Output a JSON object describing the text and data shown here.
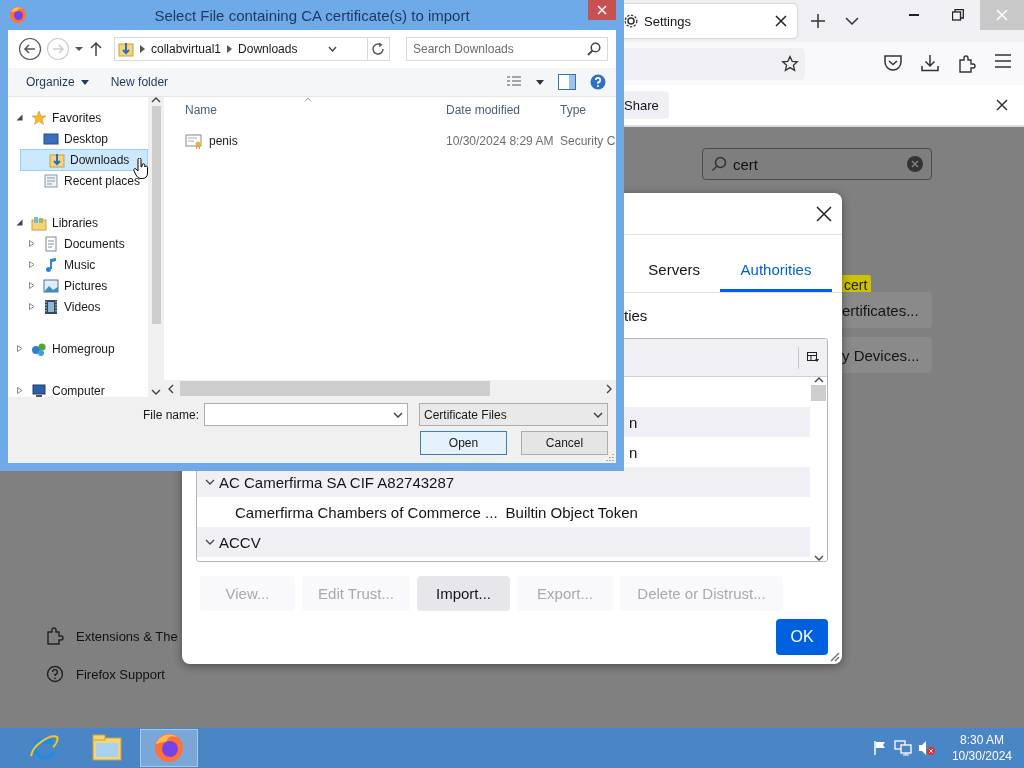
{
  "browser": {
    "tab": {
      "title": "Settings",
      "selected": true
    },
    "notification_bar": {
      "button": "Share"
    },
    "settings_search": {
      "value": "cert"
    },
    "search_highlight": "cert",
    "settings_buttons": [
      "ertificates...",
      "y Devices..."
    ],
    "sidebar_links": [
      {
        "kind": "extensions",
        "label": "Extensions & The"
      },
      {
        "kind": "support",
        "label": "Firefox Support"
      }
    ]
  },
  "certificate_manager": {
    "tabs": [
      {
        "label": "Servers",
        "selected": false
      },
      {
        "label": "Authorities",
        "selected": true
      }
    ],
    "caption": "ties",
    "rows": [
      {
        "kind": "partial",
        "text": "n"
      },
      {
        "kind": "partial",
        "text": "n"
      },
      {
        "kind": "group",
        "text": "AC Camerfirma SA CIF A82743287",
        "expanded": true
      },
      {
        "kind": "cert",
        "text": "Camerfirma Chambers of Commerce ...",
        "token": "Builtin Object Token"
      },
      {
        "kind": "group",
        "text": "ACCV",
        "expanded": true
      }
    ],
    "buttons": [
      {
        "label": "View...",
        "disabled": true
      },
      {
        "label": "Edit Trust...",
        "disabled": true
      },
      {
        "label": "Import...",
        "disabled": false
      },
      {
        "label": "Export...",
        "disabled": true
      },
      {
        "label": "Delete or Distrust...",
        "disabled": true
      }
    ],
    "ok_button": "OK"
  },
  "file_dialog": {
    "title": "Select File containing CA certificate(s) to import",
    "breadcrumb": [
      "collabvirtual1",
      "Downloads"
    ],
    "search": {
      "placeholder": "Search Downloads"
    },
    "toolbar": [
      {
        "label": "Organize",
        "menu": true
      },
      {
        "label": "New folder",
        "menu": false
      }
    ],
    "tree": [
      {
        "label": "Favorites",
        "kind": "favorites",
        "expanded": true,
        "selected": false,
        "children": [
          {
            "label": "Desktop",
            "kind": "desktop",
            "selected": false
          },
          {
            "label": "Downloads",
            "kind": "downloads",
            "selected": true
          },
          {
            "label": "Recent places",
            "kind": "recent",
            "selected": false
          }
        ]
      },
      {
        "label": "Libraries",
        "kind": "libraries",
        "expanded": true,
        "selected": false,
        "children": [
          {
            "label": "Documents",
            "kind": "documents",
            "expanded": false,
            "selected": false
          },
          {
            "label": "Music",
            "kind": "music",
            "expanded": false,
            "selected": false
          },
          {
            "label": "Pictures",
            "kind": "pictures",
            "expanded": false,
            "selected": false
          },
          {
            "label": "Videos",
            "kind": "videos",
            "expanded": false,
            "selected": false
          }
        ]
      },
      {
        "label": "Homegroup",
        "kind": "homegroup",
        "expanded": false,
        "selected": false
      },
      {
        "label": "Computer",
        "kind": "computer",
        "expanded": false,
        "selected": false
      }
    ],
    "columns": [
      "Name",
      "Date modified",
      "Type"
    ],
    "files": [
      {
        "name": "penis",
        "date_modified": "10/30/2024 8:29 AM",
        "type": "Security C"
      }
    ],
    "file_name": {
      "label": "File name:"
    },
    "filter": "Certificate Files",
    "buttons": [
      "Open",
      "Cancel"
    ]
  },
  "taskbar": {
    "apps": [
      {
        "kind": "ie",
        "selected": false
      },
      {
        "kind": "explorer",
        "selected": false
      },
      {
        "kind": "firefox",
        "selected": true
      }
    ],
    "clock": {
      "time": "8:30 AM",
      "date": "10/30/2024"
    }
  }
}
